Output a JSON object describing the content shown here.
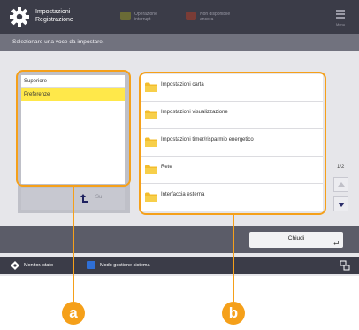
{
  "header": {
    "title_line1": "Impostazioni",
    "title_line2": "Registrazione",
    "btn1_label": "Operazione interrupt",
    "btn2_label": "Non disponibile ancora",
    "menu_label": "Menu",
    "btn1_color": "#6a6b36",
    "btn2_color": "#7a3c36"
  },
  "instruction": "Selezionare una voce da impostare.",
  "left_panel": {
    "items": [
      "Superiore",
      "Preferenze"
    ],
    "selected_color": "#ffe84a",
    "up_label": "Su"
  },
  "right_panel": {
    "items": [
      "Impostazioni carta",
      "Impostazioni visualizzazione",
      "Impostazioni timer/risparmio energetico",
      "Rete",
      "Interfaccia esterna"
    ]
  },
  "pager": {
    "text": "1/2"
  },
  "footer": {
    "close_label": "Chiudi"
  },
  "status_bar": {
    "monitor_label": "Monitor. stato",
    "system_mode_label": "Modo gestione sistema"
  },
  "callouts": {
    "a": "a",
    "b": "b",
    "color": "#f5a01a"
  }
}
